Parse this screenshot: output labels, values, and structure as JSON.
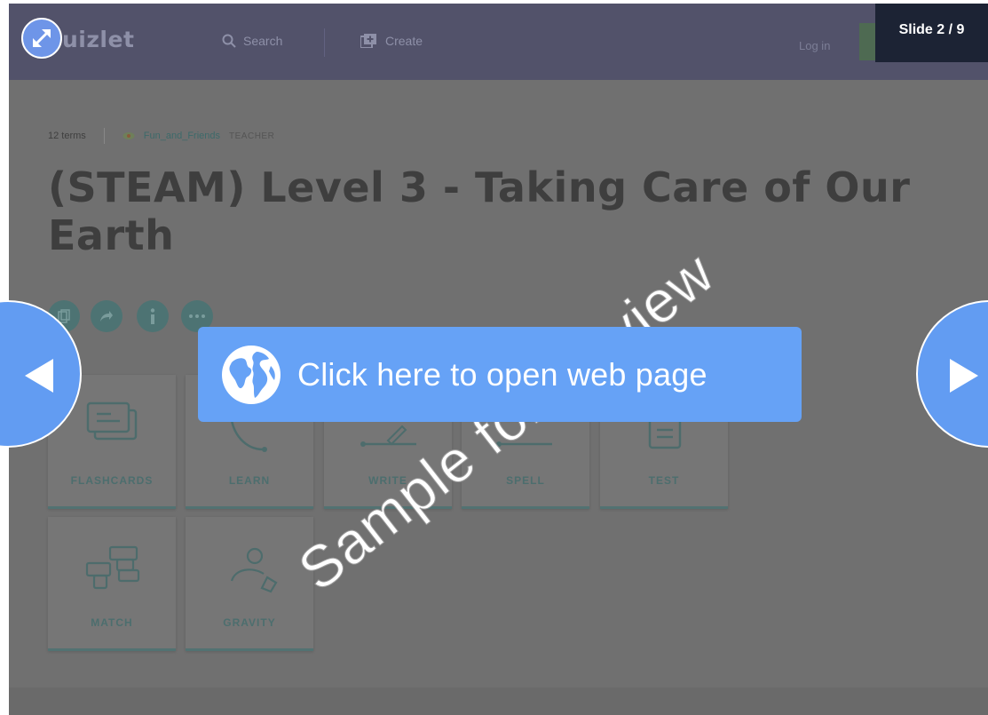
{
  "viewer": {
    "slide_counter": "Slide 2 / 9",
    "open_button_label": "Click here to open web page",
    "watermark": "Sample for Review"
  },
  "quizlet": {
    "logo_text": "uizlet",
    "search_label": "Search",
    "create_label": "Create",
    "login_label": "Log in"
  },
  "set": {
    "terms": "12 terms",
    "username": "Fun_and_Friends",
    "role": "TEACHER",
    "title": "(STEAM) Level 3 - Taking Care of Our Earth"
  },
  "study_modes": [
    {
      "label": "FLASHCARDS"
    },
    {
      "label": "LEARN"
    },
    {
      "label": "WRITE"
    },
    {
      "label": "SPELL"
    },
    {
      "label": "TEST"
    },
    {
      "label": "MATCH"
    },
    {
      "label": "GRAVITY"
    }
  ],
  "colors": {
    "nav_button": "#629cf2",
    "open_button": "#66a2f6",
    "counter_bg": "#1c2334",
    "dim_overlay": "#707070"
  },
  "icons": {
    "expand": "expand-arrows-icon",
    "prev": "triangle-left-icon",
    "next": "triangle-right-icon",
    "globe": "globe-icon"
  }
}
